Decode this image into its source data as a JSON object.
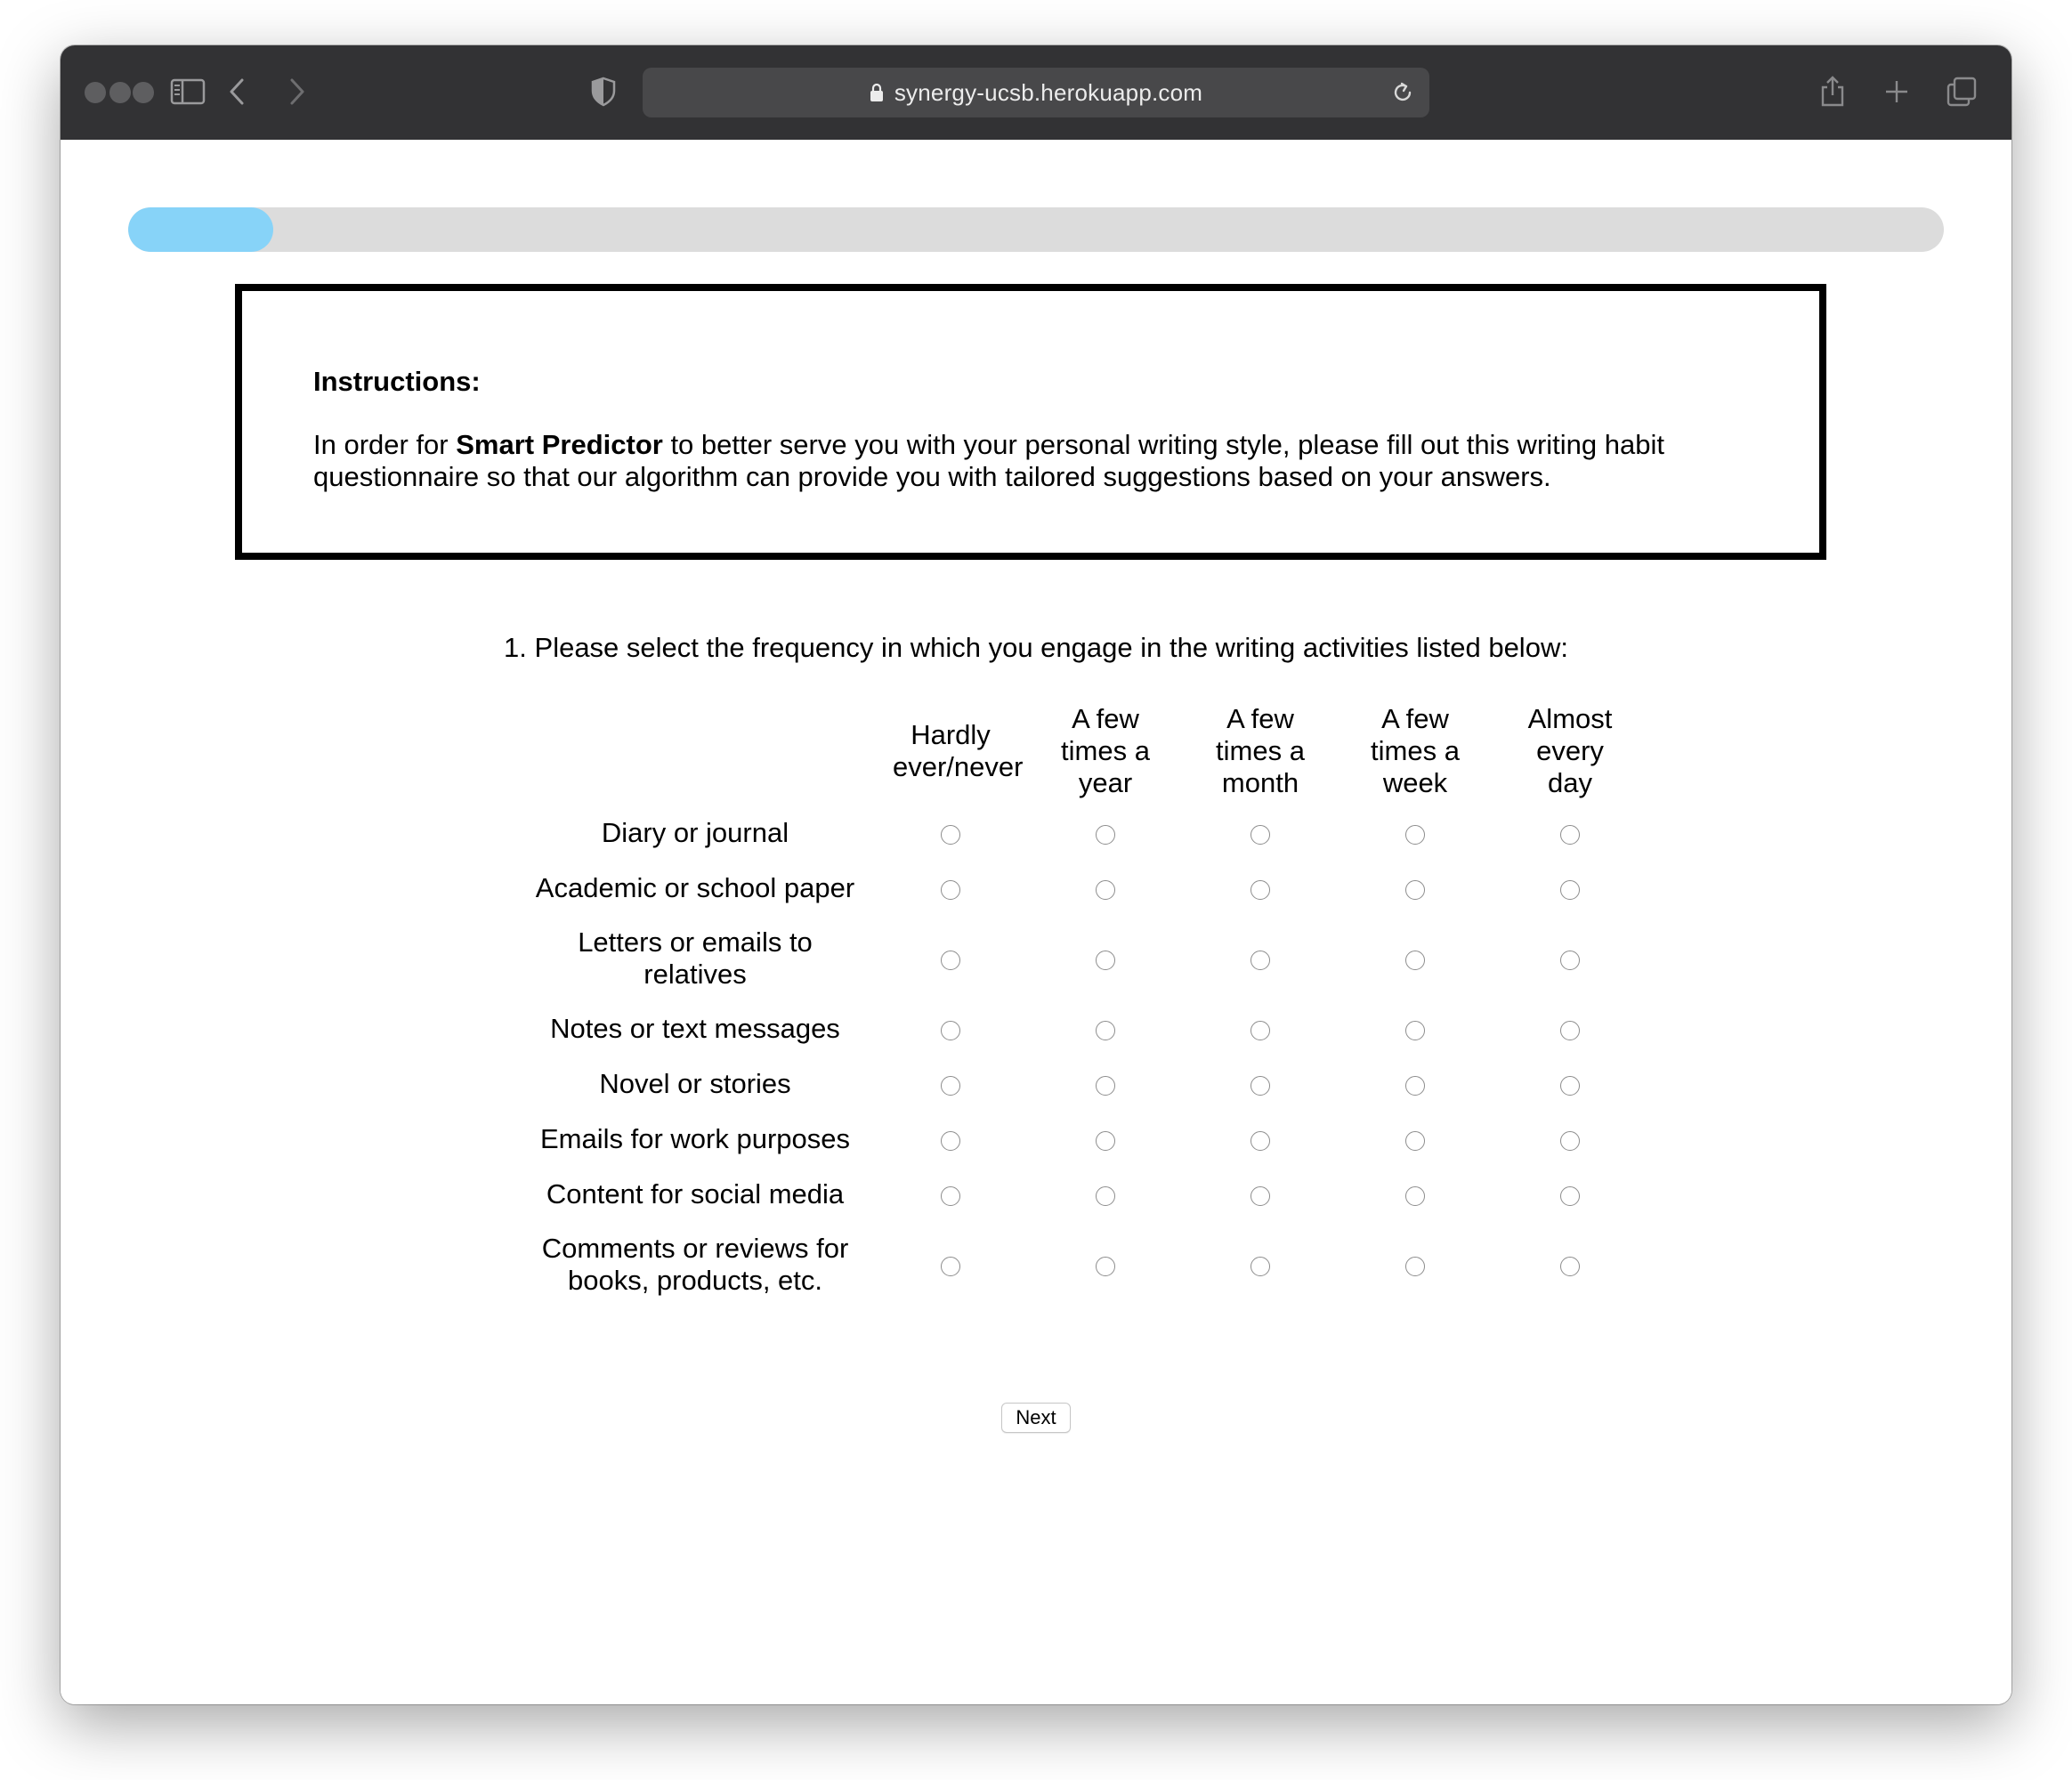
{
  "browser": {
    "url": "synergy-ucsb.herokuapp.com"
  },
  "progress": {
    "fraction": 0.08
  },
  "instructions": {
    "title": "Instructions:",
    "body_prefix": "In order for ",
    "body_bold": "Smart Predictor",
    "body_suffix": " to better serve you with your personal writing style, please fill out this writing habit questionnaire so that our algorithm can provide you with tailored suggestions based on your answers."
  },
  "question": {
    "text": "1. Please select the frequency in which you engage in the writing activities listed below:",
    "options": [
      "Hardly ever/never",
      "A few times a year",
      "A few times a month",
      "A few times a week",
      "Almost every day"
    ],
    "items": [
      "Diary or journal",
      "Academic or school paper",
      "Letters or emails to relatives",
      "Notes or text messages",
      "Novel or stories",
      "Emails for work purposes",
      "Content for social media",
      "Comments or reviews for books, products, etc."
    ]
  },
  "next_label": "Next"
}
